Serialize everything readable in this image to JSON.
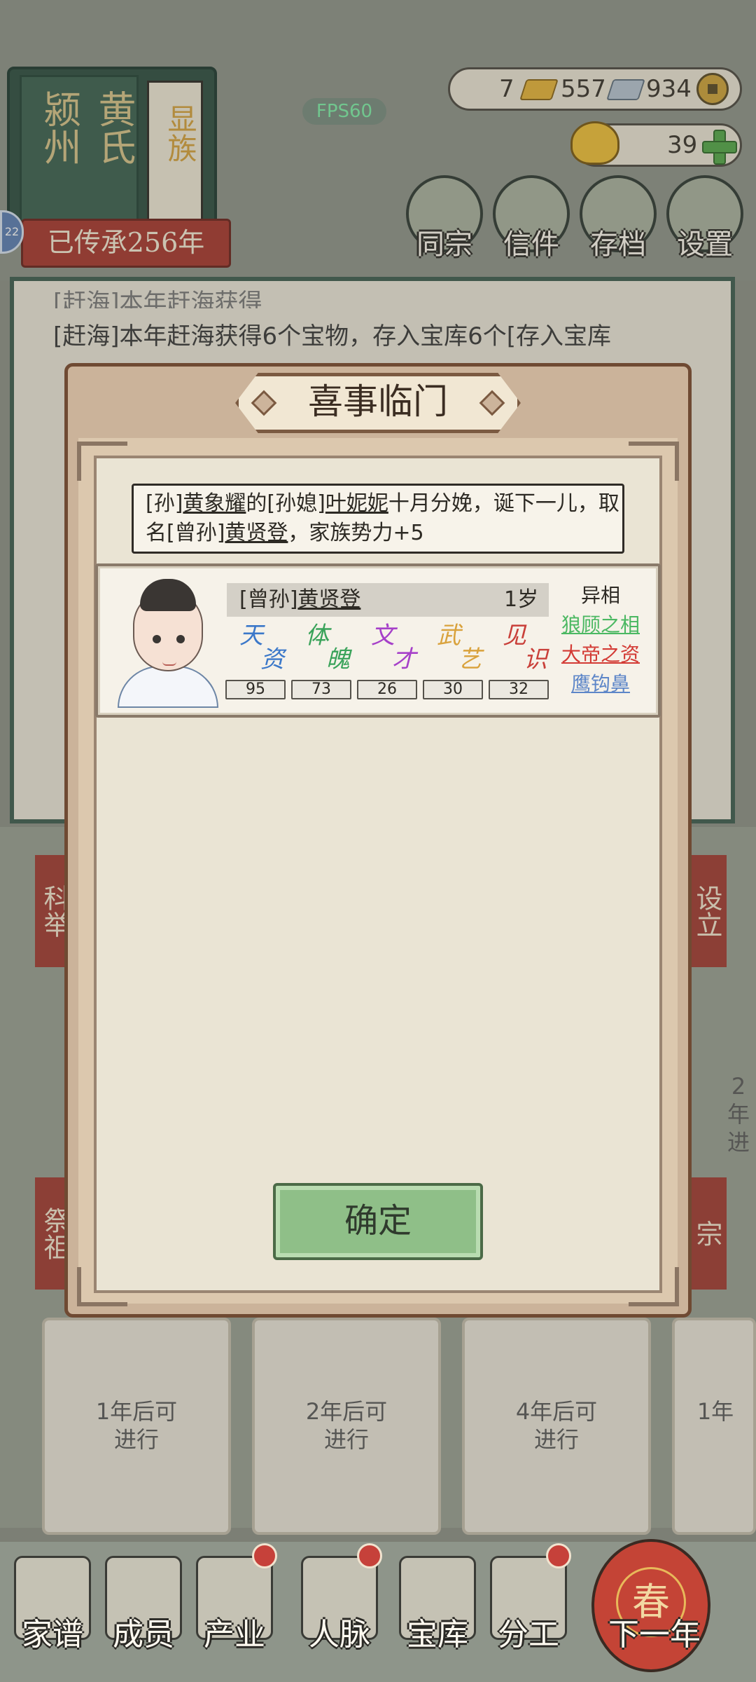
{
  "header": {
    "family_region": "颍州",
    "family_name": "黄氏",
    "family_rank": "显族",
    "heritage": "已传承256年",
    "badge_number": "22",
    "fps": "FPS60"
  },
  "resources": {
    "gold": "7",
    "silver": "557",
    "coins": "934",
    "ingots": "39"
  },
  "top_buttons": [
    {
      "label": "同宗",
      "icon": "clan-books-icon"
    },
    {
      "label": "信件",
      "icon": "letter-icon"
    },
    {
      "label": "存档",
      "icon": "scroll-brush-icon"
    },
    {
      "label": "设置",
      "icon": "gear-icon"
    }
  ],
  "background_log": {
    "line1": "[赶海]本年赶海获得6个宝物，存入宝库6个[存入宝库",
    "line0_partial": "[赶海]本年赶海获得"
  },
  "background_cards": {
    "tag_left_1": "科举",
    "tag_left_2": "祭祖",
    "tag_right_1": "设立",
    "tag_right_2": "宗",
    "card1": "1年后可\n进行",
    "card2": "2年后可\n进行",
    "card3": "4年后可\n进行",
    "card4": "1年",
    "card_right_top": "2年\n进"
  },
  "modal": {
    "title": "喜事临门",
    "event": {
      "p1": "[孙]",
      "n1": "黄象耀",
      "p2": "的[孙媳]",
      "n2": "叶妮妮",
      "p3": "十月分娩，诞下一儿，取名[曾孙]",
      "n3": "黄贤登",
      "p4": "，家族势力+5"
    },
    "child": {
      "relation": "[曾孙]",
      "name": "黄贤登",
      "age": "1岁",
      "attributes": [
        {
          "label_a": "天",
          "label_b": "资",
          "value": "95",
          "color": "#3b78c9"
        },
        {
          "label_a": "体",
          "label_b": "魄",
          "value": "73",
          "color": "#3aa35a"
        },
        {
          "label_a": "文",
          "label_b": "才",
          "value": "26",
          "color": "#a640c9"
        },
        {
          "label_a": "武",
          "label_b": "艺",
          "value": "30",
          "color": "#d9a23c"
        },
        {
          "label_a": "见",
          "label_b": "识",
          "value": "32",
          "color": "#c9403a"
        }
      ],
      "traits_title": "异相",
      "traits": [
        {
          "label": "狼顾之相",
          "color": "#4bb862"
        },
        {
          "label": "大帝之资",
          "color": "#d33a34"
        },
        {
          "label": "鹰钩鼻",
          "color": "#5d86c8"
        }
      ]
    },
    "confirm_label": "确定"
  },
  "bottom_nav": [
    {
      "label": "家谱",
      "icon": "genealogy-book-icon",
      "dot": false
    },
    {
      "label": "成员",
      "icon": "member-portrait-icon",
      "dot": false
    },
    {
      "label": "产业",
      "icon": "pavilion-icon",
      "dot": true
    },
    {
      "label": "人脉",
      "icon": "network-icon",
      "dot": true
    },
    {
      "label": "宝库",
      "icon": "treasure-chest-icon",
      "dot": false
    },
    {
      "label": "分工",
      "icon": "scroll-icon",
      "dot": true
    },
    {
      "label": "下一年",
      "icon": "lantern-icon",
      "dot": false
    }
  ],
  "lantern_char": "春"
}
